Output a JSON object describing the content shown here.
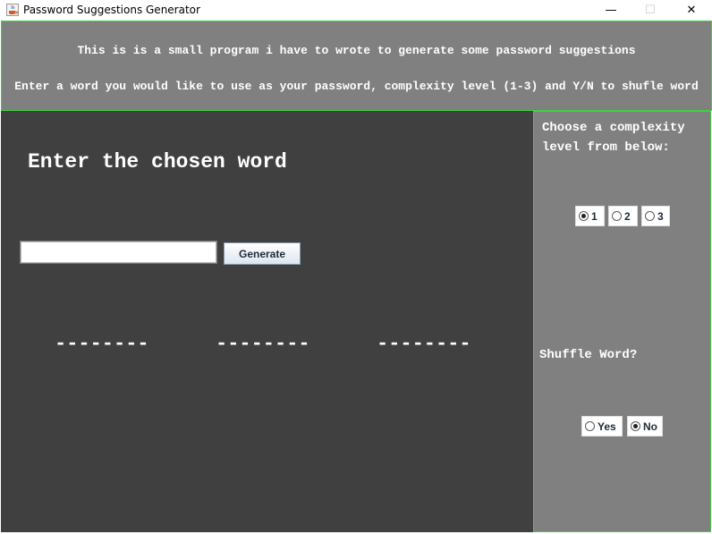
{
  "window": {
    "title": "Password Suggestions Generator",
    "minimize_glyph": "—",
    "maximize_glyph": "☐",
    "close_glyph": "✕"
  },
  "header": {
    "line1": "This is is a small program i have to wrote to generate some password suggestions",
    "line2": "Enter a word you would like to use as your password, complexity level (1-3) and Y/N to shufle word"
  },
  "main": {
    "title": "Enter the chosen word",
    "word_input_value": "",
    "generate_label": "Generate",
    "suggestions": [
      "--------",
      "--------",
      "--------"
    ]
  },
  "side": {
    "complexity_line1": "Choose a complexity",
    "complexity_line2": "level from below:",
    "complexity_options": [
      {
        "label": "1",
        "selected": true
      },
      {
        "label": "2",
        "selected": false
      },
      {
        "label": "3",
        "selected": false
      }
    ],
    "shuffle_label": "Shuffle Word?",
    "shuffle_options": [
      {
        "label": "Yes",
        "selected": false
      },
      {
        "label": "No",
        "selected": true
      }
    ]
  },
  "colors": {
    "panel_gray": "#808080",
    "main_dark": "#404040",
    "border_green": "#3fd23f"
  }
}
